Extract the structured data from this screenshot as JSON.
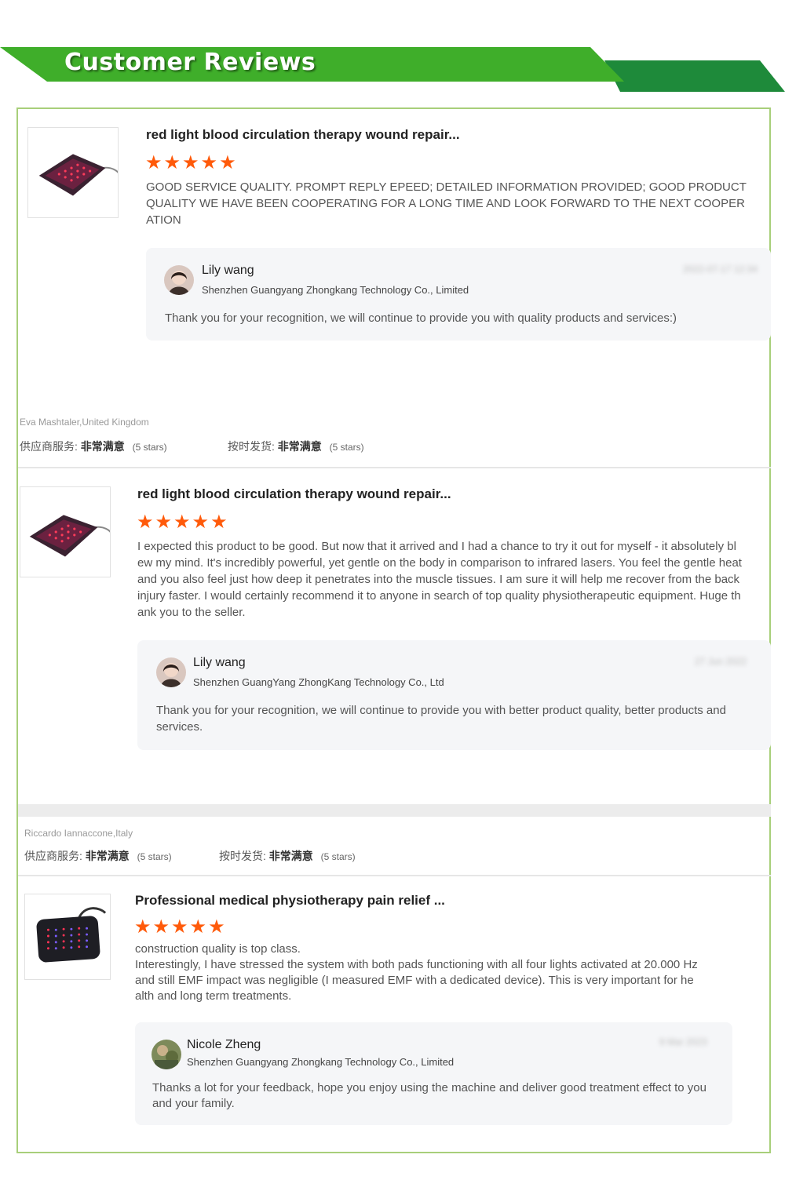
{
  "banner": {
    "title": "Customer Reviews"
  },
  "colors": {
    "banner_light": "#3fae2a",
    "banner_dark": "#1e8a3a",
    "frame_border": "#a8cf7a",
    "star": "#ff5a0a"
  },
  "reviews": [
    {
      "product_title": "red light blood circulation therapy wound repair...",
      "rating": 5,
      "text": "GOOD SERVICE QUALITY. PROMPT REPLY EPEED; DETAILED INFORMATION PROVIDED; GOOD PRODUCT QUALITY WE HAVE BEEN COOPERATING FOR A LONG TIME AND LOOK FORWARD TO THE NEXT COOPERATION",
      "reply": {
        "name": "Lily wang",
        "company": "Shenzhen Guangyang Zhongkang Technology Co., Limited",
        "date": "2022-07-17 12:34",
        "text": "Thank you for your recognition, we will continue to provide you with quality products and services:)"
      },
      "reviewer": "Eva Mashtaler,United Kingdom",
      "supplier_service": {
        "label": "供应商服务:",
        "value": "非常满意",
        "stars": "(5 stars)"
      },
      "on_time_delivery": {
        "label": "按时发货:",
        "value": "非常满意",
        "stars": "(5 stars)"
      }
    },
    {
      "product_title": "red light blood circulation therapy wound repair...",
      "rating": 5,
      "text": "I expected this product to be good. But now that it arrived and I had a chance to try it out for myself - it absolutely blew my mind. It's incredibly powerful, yet gentle on the body in comparison to infrared lasers. You feel the gentle heat and you also feel just how deep it penetrates into the muscle tissues. I am sure it will help me recover from the back injury faster. I would certainly recommend it to anyone in search of top quality physiotherapeutic equipment. Huge thank you to the seller.",
      "reply": {
        "name": "Lily wang",
        "company": "Shenzhen GuangYang ZhongKang Technology Co., Ltd",
        "date": "27 Jun 2022",
        "text": "Thank you for your recognition, we will continue to provide you with better product quality, better products and services."
      },
      "reviewer": "Riccardo Iannaccone,Italy",
      "supplier_service": {
        "label": "供应商服务:",
        "value": "非常满意",
        "stars": "(5 stars)"
      },
      "on_time_delivery": {
        "label": "按时发货:",
        "value": "非常满意",
        "stars": "(5 stars)"
      }
    },
    {
      "product_title": "Professional medical physiotherapy pain relief ...",
      "rating": 5,
      "text_lines": [
        "construction quality is top class.",
        "Interestingly, I have stressed the system with both pads functioning with all four lights activated at 20.000 Hz and still EMF impact was negligible (I measured EMF with a dedicated device). This is very important for health and long term treatments."
      ],
      "reply": {
        "name": "Nicole Zheng",
        "company": "Shenzhen Guangyang Zhongkang Technology Co., Limited",
        "date": "9 Mar 2023",
        "text": "Thanks a lot for your feedback, hope you enjoy using the machine and deliver good treatment effect to you and your family."
      }
    }
  ]
}
